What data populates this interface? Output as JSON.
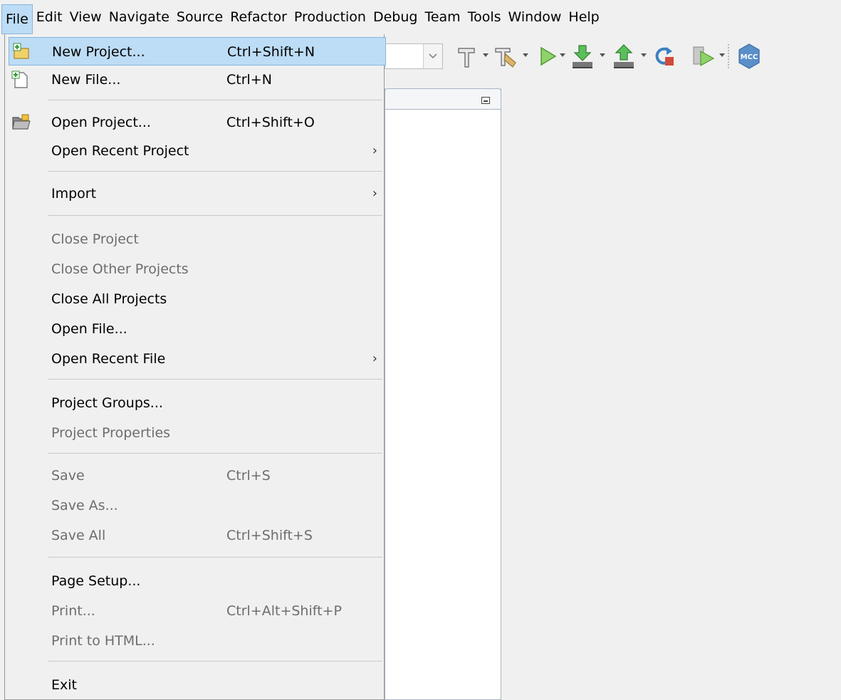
{
  "menubar": {
    "items": [
      "File",
      "Edit",
      "View",
      "Navigate",
      "Source",
      "Refactor",
      "Production",
      "Debug",
      "Team",
      "Tools",
      "Window",
      "Help"
    ],
    "active_index": 0
  },
  "file_menu": {
    "items": [
      {
        "label": "New Project...",
        "accel": "Ctrl+Shift+N",
        "enabled": true,
        "highlighted": true,
        "icon": "new-project-icon"
      },
      {
        "label": "New File...",
        "accel": "Ctrl+N",
        "enabled": true,
        "icon": "new-file-icon"
      },
      {
        "label": "Open Project...",
        "accel": "Ctrl+Shift+O",
        "enabled": true,
        "icon": "open-project-icon"
      },
      {
        "label": "Open Recent Project",
        "accel": "",
        "enabled": true,
        "submenu": true
      },
      {
        "label": "Import",
        "accel": "",
        "enabled": true,
        "submenu": true
      },
      {
        "label": "Close Project",
        "accel": "",
        "enabled": false
      },
      {
        "label": "Close Other Projects",
        "accel": "",
        "enabled": false
      },
      {
        "label": "Close All Projects",
        "accel": "",
        "enabled": true
      },
      {
        "label": "Open File...",
        "accel": "",
        "enabled": true
      },
      {
        "label": "Open Recent File",
        "accel": "",
        "enabled": true,
        "submenu": true
      },
      {
        "label": "Project Groups...",
        "accel": "",
        "enabled": true
      },
      {
        "label": "Project Properties",
        "accel": "",
        "enabled": false
      },
      {
        "label": "Save",
        "accel": "Ctrl+S",
        "enabled": false
      },
      {
        "label": "Save As...",
        "accel": "",
        "enabled": false
      },
      {
        "label": "Save All",
        "accel": "Ctrl+Shift+S",
        "enabled": false
      },
      {
        "label": "Page Setup...",
        "accel": "",
        "enabled": true
      },
      {
        "label": "Print...",
        "accel": "Ctrl+Alt+Shift+P",
        "enabled": false
      },
      {
        "label": "Print to HTML...",
        "accel": "",
        "enabled": false
      },
      {
        "label": "Exit",
        "accel": "",
        "enabled": true
      }
    ]
  },
  "toolbar": {
    "icons": [
      "project-config-combo",
      "build-hammer-icon",
      "clean-build-icon",
      "run-icon",
      "program-device-icon",
      "read-device-icon",
      "reset-icon",
      "debug-icon",
      "mcc-icon"
    ],
    "mcc_label": "MCC"
  },
  "colors": {
    "highlight": "#bddcf5",
    "highlight_border": "#86b6df",
    "disabled_text": "#6d6d6d",
    "background": "#f0f0f0"
  }
}
